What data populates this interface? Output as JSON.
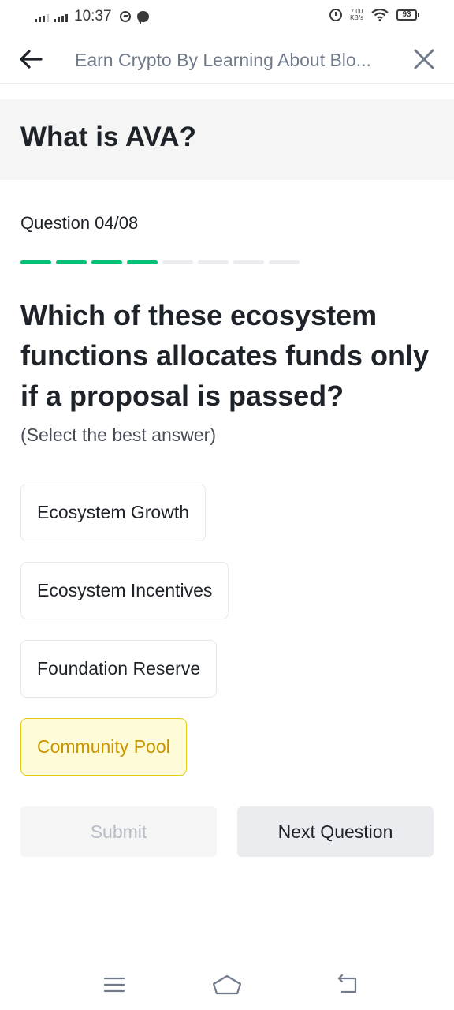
{
  "status_bar": {
    "time": "10:37",
    "network_speed_value": "7.00",
    "network_speed_unit": "KB/s",
    "battery": "93"
  },
  "header": {
    "title": "Earn Crypto By Learning About Blo...",
    "back_icon": "arrow-left-icon",
    "close_icon": "close-icon"
  },
  "quiz": {
    "title": "What is AVA?",
    "counter": "Question 04/08",
    "progress": {
      "completed": 4,
      "total": 8
    },
    "question": "Which of these ecosystem functions allocates funds only if a proposal is passed?",
    "hint": "(Select the best answer)",
    "options": [
      {
        "label": "Ecosystem Growth",
        "selected": false
      },
      {
        "label": "Ecosystem Incentives",
        "selected": false
      },
      {
        "label": "Foundation Reserve",
        "selected": false
      },
      {
        "label": "Community Pool",
        "selected": true
      }
    ],
    "submit_label": "Submit",
    "next_label": "Next Question"
  },
  "colors": {
    "progress_done": "#02c076",
    "progress_todo": "#eaecef",
    "selected_bg": "#fefbd8",
    "selected_text": "#c99400"
  },
  "nav_bar": {
    "icons": [
      "menu-icon",
      "home-icon",
      "back-icon"
    ]
  }
}
